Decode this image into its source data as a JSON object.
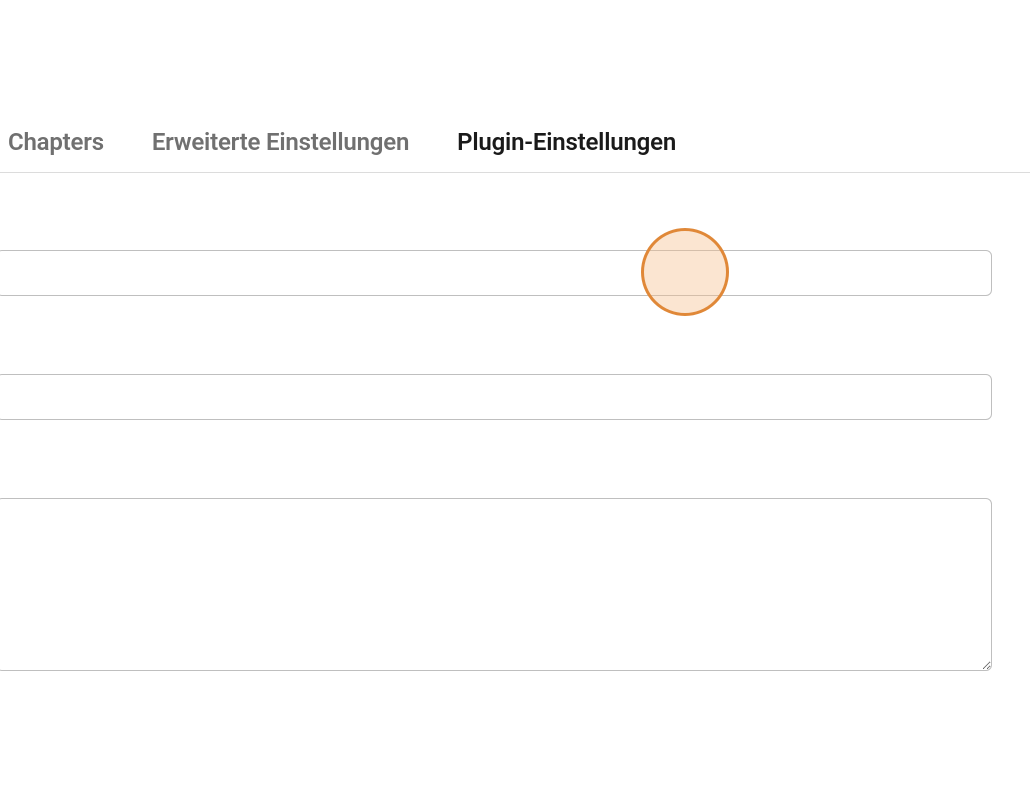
{
  "tabs": [
    {
      "label": "Chapters",
      "active": false
    },
    {
      "label": "Erweiterte Einstellungen",
      "active": false
    },
    {
      "label": "Plugin-Einstellungen",
      "active": true
    }
  ]
}
